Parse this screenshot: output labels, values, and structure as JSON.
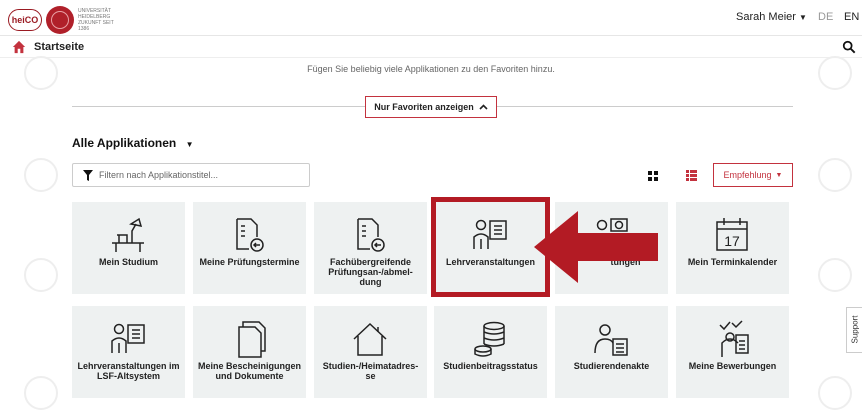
{
  "header": {
    "logo_heico": "heiCO",
    "logo_university": "UNIVERSITÄT HEIDELBERG ZUKUNFT SEIT 1386",
    "user_name": "Sarah Meier",
    "lang_de": "DE",
    "lang_en": "EN"
  },
  "nav": {
    "home_label": "Startseite"
  },
  "favorites": {
    "hint": "Fügen Sie beliebig viele Applikationen zu den Favoriten hinzu.",
    "toggle_label": "Nur Favoriten anzeigen"
  },
  "apps": {
    "section_title": "Alle Applikationen",
    "filter_placeholder": "Filtern nach Applikationstitel...",
    "sort_label": "Empfehlung",
    "tiles": [
      {
        "label": "Mein Studium",
        "icon": "desk-lamp-icon"
      },
      {
        "label": "Meine Prüfungstermine",
        "icon": "exam-document-icon"
      },
      {
        "label": "Fachübergreifende Prüfungsan-/abmel-dung",
        "icon": "exam-document-icon"
      },
      {
        "label": "Lehrveranstaltungen",
        "icon": "teacher-board-icon"
      },
      {
        "label": "tungen",
        "icon": "teacher-board-icon"
      },
      {
        "label": "Mein Terminkalender",
        "icon": "calendar-icon",
        "calendar_day": "17"
      },
      {
        "label": "Lehrveranstaltungen im LSF-Altsystem",
        "icon": "teacher-board-icon"
      },
      {
        "label": "Meine Bescheinigungen und Dokumente",
        "icon": "documents-icon"
      },
      {
        "label": "Studien-/Heimatadres-se",
        "icon": "house-icon"
      },
      {
        "label": "Studienbeitragsstatus",
        "icon": "coins-icon"
      },
      {
        "label": "Studierendenakte",
        "icon": "student-file-icon"
      },
      {
        "label": "Meine Bewerbungen",
        "icon": "application-icon"
      }
    ]
  },
  "support": {
    "label": "Support"
  },
  "colors": {
    "brand_red": "#c3323e",
    "highlight_red": "#b31b24",
    "tile_bg": "#eef1f1"
  }
}
